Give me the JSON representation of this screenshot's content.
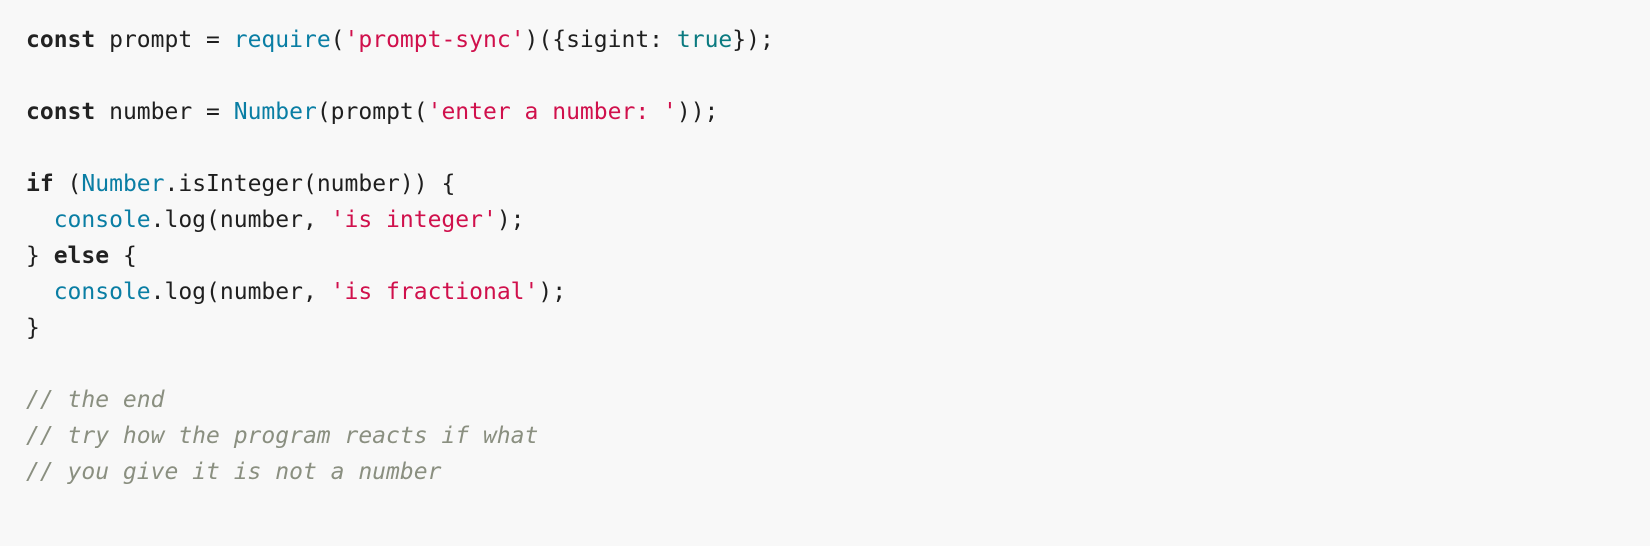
{
  "colors": {
    "background": "#f8f8f8",
    "text": "#1f1f1f",
    "keyword": "#222222",
    "builtin": "#0a7ea4",
    "boolean": "#0b7a80",
    "string": "#d0104c",
    "comment": "#8a8f80"
  },
  "code": {
    "line1": {
      "kw_const": "const",
      "mid1": " prompt = ",
      "fn_require": "require",
      "p1": "(",
      "str_module": "'prompt-sync'",
      "p2": ")({sigint: ",
      "bool_true": "true",
      "p3": "});"
    },
    "line3": {
      "kw_const": "const",
      "mid1": " number = ",
      "fn_number": "Number",
      "p1": "(prompt(",
      "str_prompt": "'enter a number: '",
      "p2": "));"
    },
    "line5": {
      "kw_if": "if",
      "p1": " (",
      "fn_number": "Number",
      "p2": ".isInteger(number)) {"
    },
    "line6": {
      "indent": "  ",
      "fn_console": "console",
      "p1": ".log(number, ",
      "str_integer": "'is integer'",
      "p2": ");"
    },
    "line7": {
      "p1": "} ",
      "kw_else": "else",
      "p2": " {"
    },
    "line8": {
      "indent": "  ",
      "fn_console": "console",
      "p1": ".log(number, ",
      "str_fractional": "'is fractional'",
      "p2": ");"
    },
    "line9": {
      "p1": "}"
    },
    "comments": [
      "// the end",
      "// try how the program reacts if what",
      "// you give it is not a number"
    ]
  }
}
